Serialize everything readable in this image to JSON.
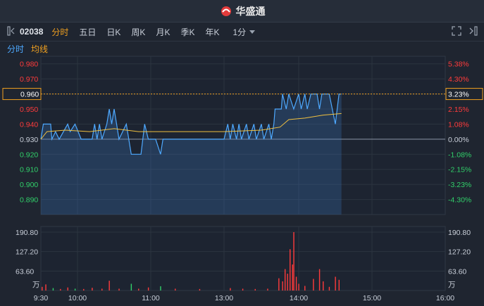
{
  "header": {
    "brand": "华盛通"
  },
  "toolbar": {
    "code": "02038",
    "tabs": [
      "分时",
      "五日",
      "日K",
      "周K",
      "月K",
      "季K",
      "年K"
    ],
    "period": "1分"
  },
  "legend": {
    "intraday": "分时",
    "average": "均线"
  },
  "colors": {
    "up": "#ff3b3b",
    "down": "#31d06a",
    "price": "#4ea9ff",
    "average": "#f0c040",
    "highlight": "#f0a020"
  },
  "chart_data": {
    "type": "line",
    "prev_close": 0.93,
    "price_axis": {
      "ylim": [
        0.88,
        0.985
      ],
      "ticks": [
        "0.980",
        "0.970",
        "0.960",
        "0.950",
        "0.940",
        "0.930",
        "0.920",
        "0.910",
        "0.900",
        "0.890"
      ],
      "pct_ticks": [
        "5.38%",
        "4.30%",
        "3.23%",
        "2.15%",
        "1.08%",
        "0.00%",
        "-1.08%",
        "-2.15%",
        "-3.23%",
        "-4.30%"
      ]
    },
    "highlight": {
      "price": 0.96,
      "price_label": "0.960",
      "pct_label": "3.23%"
    },
    "volume_axis": {
      "ylim": [
        0,
        190.8
      ],
      "ticks": [
        "190.80",
        "127.20",
        "63.60"
      ],
      "unit": "万"
    },
    "time_axis": [
      "9:30",
      "10:00",
      "11:00",
      "13:00",
      "14:00",
      "15:00",
      "16:00"
    ],
    "price_series": [
      {
        "t": "09:30",
        "v": 0.93
      },
      {
        "t": "09:32",
        "v": 0.94
      },
      {
        "t": "09:38",
        "v": 0.94
      },
      {
        "t": "09:39",
        "v": 0.93
      },
      {
        "t": "09:42",
        "v": 0.935
      },
      {
        "t": "09:45",
        "v": 0.93
      },
      {
        "t": "09:52",
        "v": 0.94
      },
      {
        "t": "09:54",
        "v": 0.935
      },
      {
        "t": "09:58",
        "v": 0.94
      },
      {
        "t": "10:03",
        "v": 0.93
      },
      {
        "t": "10:12",
        "v": 0.93
      },
      {
        "t": "10:14",
        "v": 0.94
      },
      {
        "t": "10:16",
        "v": 0.93
      },
      {
        "t": "10:18",
        "v": 0.94
      },
      {
        "t": "10:20",
        "v": 0.93
      },
      {
        "t": "10:24",
        "v": 0.94
      },
      {
        "t": "10:26",
        "v": 0.95
      },
      {
        "t": "10:28",
        "v": 0.94
      },
      {
        "t": "10:30",
        "v": 0.95
      },
      {
        "t": "10:32",
        "v": 0.94
      },
      {
        "t": "10:34",
        "v": 0.93
      },
      {
        "t": "10:40",
        "v": 0.94
      },
      {
        "t": "10:42",
        "v": 0.93
      },
      {
        "t": "10:44",
        "v": 0.92
      },
      {
        "t": "10:52",
        "v": 0.92
      },
      {
        "t": "10:55",
        "v": 0.94
      },
      {
        "t": "10:58",
        "v": 0.93
      },
      {
        "t": "11:02",
        "v": 0.93
      },
      {
        "t": "11:04",
        "v": 0.92
      },
      {
        "t": "11:05",
        "v": 0.93
      },
      {
        "t": "11:30",
        "v": 0.93
      },
      {
        "t": "13:00",
        "v": 0.93
      },
      {
        "t": "13:03",
        "v": 0.94
      },
      {
        "t": "13:05",
        "v": 0.93
      },
      {
        "t": "13:07",
        "v": 0.94
      },
      {
        "t": "13:10",
        "v": 0.93
      },
      {
        "t": "13:12",
        "v": 0.94
      },
      {
        "t": "13:14",
        "v": 0.93
      },
      {
        "t": "13:18",
        "v": 0.94
      },
      {
        "t": "13:20",
        "v": 0.93
      },
      {
        "t": "13:24",
        "v": 0.94
      },
      {
        "t": "13:26",
        "v": 0.93
      },
      {
        "t": "13:30",
        "v": 0.94
      },
      {
        "t": "13:32",
        "v": 0.93
      },
      {
        "t": "13:36",
        "v": 0.94
      },
      {
        "t": "13:38",
        "v": 0.93
      },
      {
        "t": "13:40",
        "v": 0.94
      },
      {
        "t": "13:41",
        "v": 0.95
      },
      {
        "t": "13:46",
        "v": 0.95
      },
      {
        "t": "13:47",
        "v": 0.96
      },
      {
        "t": "13:50",
        "v": 0.95
      },
      {
        "t": "13:52",
        "v": 0.96
      },
      {
        "t": "13:56",
        "v": 0.95
      },
      {
        "t": "14:00",
        "v": 0.96
      },
      {
        "t": "14:02",
        "v": 0.95
      },
      {
        "t": "14:05",
        "v": 0.96
      },
      {
        "t": "14:07",
        "v": 0.95
      },
      {
        "t": "14:10",
        "v": 0.96
      },
      {
        "t": "14:15",
        "v": 0.96
      },
      {
        "t": "14:17",
        "v": 0.95
      },
      {
        "t": "14:19",
        "v": 0.96
      },
      {
        "t": "14:25",
        "v": 0.96
      },
      {
        "t": "14:30",
        "v": 0.94
      },
      {
        "t": "14:33",
        "v": 0.96
      },
      {
        "t": "14:35",
        "v": 0.96
      }
    ],
    "average_series": [
      {
        "t": "09:30",
        "v": 0.93
      },
      {
        "t": "09:35",
        "v": 0.935
      },
      {
        "t": "09:50",
        "v": 0.936
      },
      {
        "t": "10:10",
        "v": 0.935
      },
      {
        "t": "10:30",
        "v": 0.937
      },
      {
        "t": "10:50",
        "v": 0.935
      },
      {
        "t": "11:30",
        "v": 0.935
      },
      {
        "t": "13:00",
        "v": 0.935
      },
      {
        "t": "13:30",
        "v": 0.936
      },
      {
        "t": "13:45",
        "v": 0.938
      },
      {
        "t": "13:52",
        "v": 0.943
      },
      {
        "t": "14:05",
        "v": 0.944
      },
      {
        "t": "14:20",
        "v": 0.946
      },
      {
        "t": "14:35",
        "v": 0.947
      }
    ],
    "volume_series": [
      {
        "t": "09:31",
        "v": 12,
        "d": "up"
      },
      {
        "t": "09:34",
        "v": 20,
        "d": "up"
      },
      {
        "t": "09:40",
        "v": 8,
        "d": "down"
      },
      {
        "t": "09:46",
        "v": 5,
        "d": "up"
      },
      {
        "t": "09:52",
        "v": 10,
        "d": "up"
      },
      {
        "t": "09:58",
        "v": 6,
        "d": "down"
      },
      {
        "t": "10:05",
        "v": 5,
        "d": "up"
      },
      {
        "t": "10:12",
        "v": 9,
        "d": "up"
      },
      {
        "t": "10:20",
        "v": 6,
        "d": "up"
      },
      {
        "t": "10:26",
        "v": 32,
        "d": "up"
      },
      {
        "t": "10:34",
        "v": 6,
        "d": "up"
      },
      {
        "t": "10:44",
        "v": 22,
        "d": "down"
      },
      {
        "t": "10:50",
        "v": 6,
        "d": "up"
      },
      {
        "t": "10:58",
        "v": 10,
        "d": "up"
      },
      {
        "t": "11:04",
        "v": 14,
        "d": "down"
      },
      {
        "t": "11:10",
        "v": 6,
        "d": "up"
      },
      {
        "t": "11:20",
        "v": 5,
        "d": "up"
      },
      {
        "t": "13:05",
        "v": 8,
        "d": "up"
      },
      {
        "t": "13:15",
        "v": 6,
        "d": "up"
      },
      {
        "t": "13:25",
        "v": 5,
        "d": "up"
      },
      {
        "t": "13:35",
        "v": 6,
        "d": "up"
      },
      {
        "t": "13:44",
        "v": 40,
        "d": "up"
      },
      {
        "t": "13:47",
        "v": 30,
        "d": "up"
      },
      {
        "t": "13:49",
        "v": 70,
        "d": "up"
      },
      {
        "t": "13:51",
        "v": 55,
        "d": "up"
      },
      {
        "t": "13:53",
        "v": 135,
        "d": "up"
      },
      {
        "t": "13:55",
        "v": 85,
        "d": "up"
      },
      {
        "t": "13:56",
        "v": 190.8,
        "d": "up"
      },
      {
        "t": "13:58",
        "v": 45,
        "d": "up"
      },
      {
        "t": "14:00",
        "v": 22,
        "d": "up"
      },
      {
        "t": "14:05",
        "v": 15,
        "d": "up"
      },
      {
        "t": "14:12",
        "v": 38,
        "d": "up"
      },
      {
        "t": "14:17",
        "v": 70,
        "d": "up"
      },
      {
        "t": "14:20",
        "v": 30,
        "d": "up"
      },
      {
        "t": "14:25",
        "v": 12,
        "d": "up"
      },
      {
        "t": "14:30",
        "v": 45,
        "d": "up"
      },
      {
        "t": "14:33",
        "v": 35,
        "d": "up"
      }
    ]
  }
}
